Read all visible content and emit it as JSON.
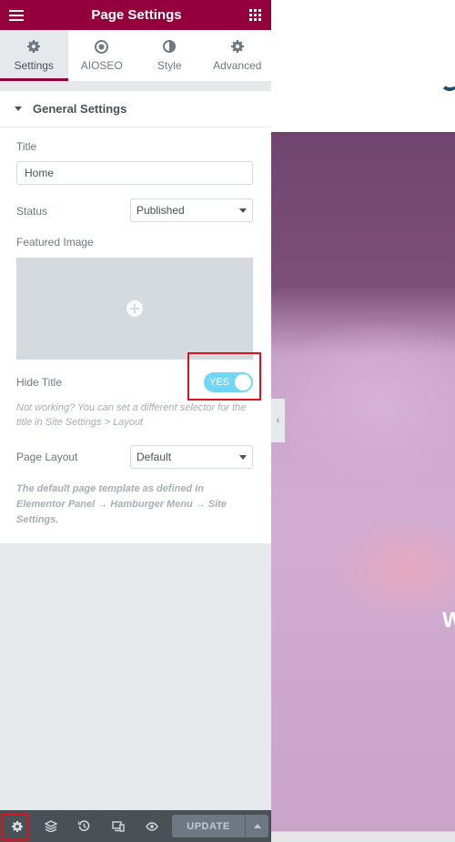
{
  "header": {
    "title": "Page Settings"
  },
  "tabs": [
    {
      "label": "Settings",
      "icon": "gear-icon",
      "active": true
    },
    {
      "label": "AIOSEO",
      "icon": "aioseo-icon",
      "active": false
    },
    {
      "label": "Style",
      "icon": "half-circle-icon",
      "active": false
    },
    {
      "label": "Advanced",
      "icon": "gear-icon",
      "active": false
    }
  ],
  "section": {
    "title": "General Settings"
  },
  "fields": {
    "title_label": "Title",
    "title_value": "Home",
    "status_label": "Status",
    "status_value": "Published",
    "featured_label": "Featured Image",
    "hide_title_label": "Hide Title",
    "hide_title_value": "YES",
    "hide_title_note": "Not working? You can set a different selector for the title in Site Settings > Layout",
    "layout_label": "Page Layout",
    "layout_value": "Default",
    "layout_note": "The default page template as defined in Elementor Panel → Hamburger Menu → Site Settings."
  },
  "footer": {
    "update_label": "UPDATE"
  },
  "preview": {
    "hero_text": "W"
  },
  "colors": {
    "brand": "#93003c",
    "toggle": "#71d7f7",
    "highlight": "#e0101e",
    "footer": "#495157"
  }
}
